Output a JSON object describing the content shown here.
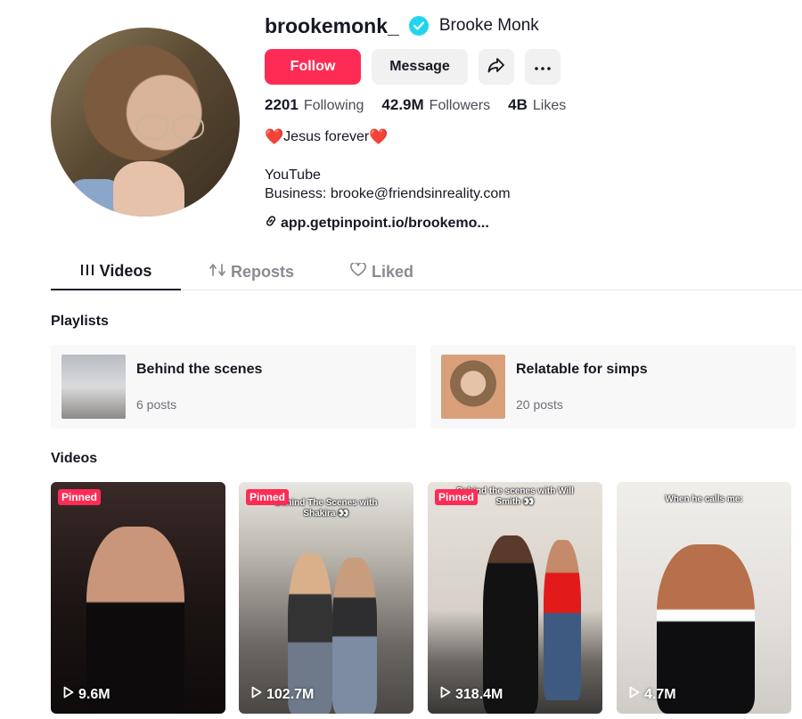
{
  "profile": {
    "username": "brookemonk_",
    "display_name": "Brooke Monk",
    "verified": true,
    "avatar_icon": "profile-photo"
  },
  "actions": {
    "follow_label": "Follow",
    "message_label": "Message",
    "share_icon": "share-arrow-icon",
    "more_icon": "more-dots-icon",
    "accent_color": "#fe2c55"
  },
  "stats": {
    "following_count": "2201",
    "following_label": "Following",
    "followers_count": "42.9M",
    "followers_label": "Followers",
    "likes_count": "4B",
    "likes_label": "Likes"
  },
  "bio": {
    "line1_heart_left": "❤️",
    "line1_text": "Jesus forever",
    "line1_heart_right": "❤️",
    "line2": "YouTube",
    "line3": "Business: brooke@friendsinreality.com",
    "link": "app.getpinpoint.io/brookemo..."
  },
  "tabs": [
    {
      "label": "Videos",
      "icon": "grid-lines-icon",
      "active": true
    },
    {
      "label": "Reposts",
      "icon": "repost-icon",
      "active": false
    },
    {
      "label": "Liked",
      "icon": "heart-outline-icon",
      "active": false
    }
  ],
  "playlists": {
    "title": "Playlists",
    "items": [
      {
        "name": "Behind the scenes",
        "count": "6 posts"
      },
      {
        "name": "Relatable for simps",
        "count": "20 posts"
      }
    ]
  },
  "videos": {
    "title": "Videos",
    "items": [
      {
        "pinned": "Pinned",
        "caption": "",
        "views": "9.6M"
      },
      {
        "pinned": "Pinned",
        "caption": "Behind The Scenes with Shakira 👀",
        "views": "102.7M"
      },
      {
        "pinned": "Pinned",
        "caption": "Behind the scenes with Will Smith 👀",
        "views": "318.4M"
      },
      {
        "pinned": "",
        "caption": "When he calls me:",
        "views": "4.7M"
      }
    ]
  }
}
